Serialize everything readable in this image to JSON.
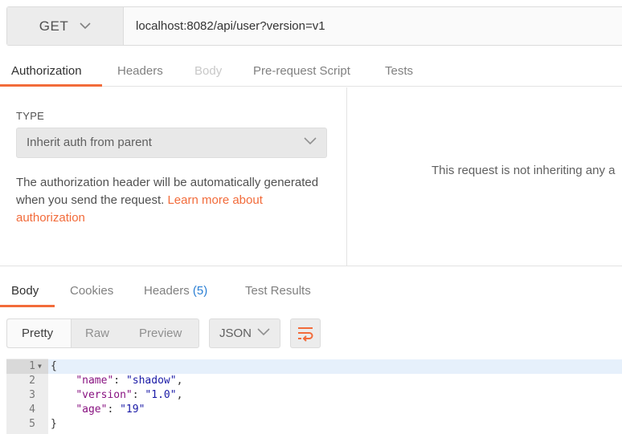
{
  "request": {
    "method": "GET",
    "url": "localhost:8082/api/user?version=v1"
  },
  "request_tabs": [
    "Authorization",
    "Headers",
    "Body",
    "Pre-request Script",
    "Tests"
  ],
  "auth": {
    "type_label": "TYPE",
    "type_value": "Inherit auth from parent",
    "description": "The authorization header will be automatically generated when you send the request.",
    "learn_more_link": "Learn more about authorization",
    "right_message": "This request is not inheriting any a"
  },
  "response_tabs": {
    "body": "Body",
    "cookies": "Cookies",
    "headers": "Headers",
    "headers_count": "(5)",
    "test_results": "Test Results"
  },
  "view_modes": [
    "Pretty",
    "Raw",
    "Preview"
  ],
  "format": "JSON",
  "code": {
    "line_numbers": [
      "1",
      "2",
      "3",
      "4",
      "5"
    ],
    "open_brace": "{",
    "close_brace": "}",
    "fields": [
      {
        "key": "\"name\"",
        "value": "\"shadow\"",
        "trail": ","
      },
      {
        "key": "\"version\"",
        "value": "\"1.0\"",
        "trail": ","
      },
      {
        "key": "\"age\"",
        "value": "\"19\"",
        "trail": ""
      }
    ]
  },
  "colors": {
    "accent": "#f26b3a",
    "link_count": "#2a7fd4",
    "json_key": "#881280",
    "json_string": "#1a1aa6"
  },
  "icons": {
    "method_dropdown": "chevron-down-icon",
    "auth_dropdown": "chevron-down-icon",
    "format_dropdown": "chevron-down-icon",
    "wrap": "wrap-lines-icon",
    "fold": "fold-arrow-icon"
  }
}
